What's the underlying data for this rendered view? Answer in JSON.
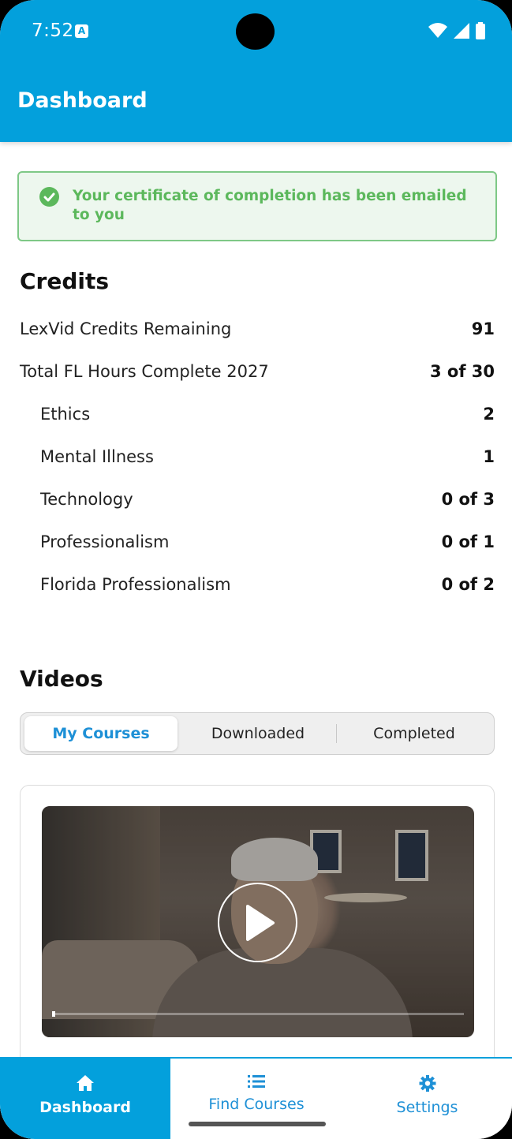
{
  "status_bar": {
    "time": "7:52",
    "app_icon_letter": "A"
  },
  "app_bar": {
    "title": "Dashboard"
  },
  "banner": {
    "message": "Your certificate of completion has been emailed to you"
  },
  "credits": {
    "title": "Credits",
    "rows": [
      {
        "label": "LexVid Credits Remaining",
        "value": "91"
      },
      {
        "label": "Total FL Hours Complete 2027",
        "value": "3 of 30"
      },
      {
        "label": "Ethics",
        "value": "2"
      },
      {
        "label": "Mental Illness",
        "value": "1"
      },
      {
        "label": "Technology",
        "value": "0 of 3"
      },
      {
        "label": "Professionalism",
        "value": "0 of 1"
      },
      {
        "label": "Florida Professionalism",
        "value": "0 of 2"
      }
    ]
  },
  "videos": {
    "title": "Videos",
    "tabs": [
      {
        "label": "My Courses",
        "active": true
      },
      {
        "label": "Downloaded",
        "active": false
      },
      {
        "label": "Completed",
        "active": false
      }
    ]
  },
  "bottom_nav": {
    "items": [
      {
        "label": "Dashboard",
        "icon": "home-icon",
        "active": true
      },
      {
        "label": "Find Courses",
        "icon": "list-icon",
        "active": false
      },
      {
        "label": "Settings",
        "icon": "gear-icon",
        "active": false
      }
    ]
  },
  "colors": {
    "primary": "#03a0dc",
    "success": "#5cb85c",
    "accent_text": "#1e90d6"
  }
}
